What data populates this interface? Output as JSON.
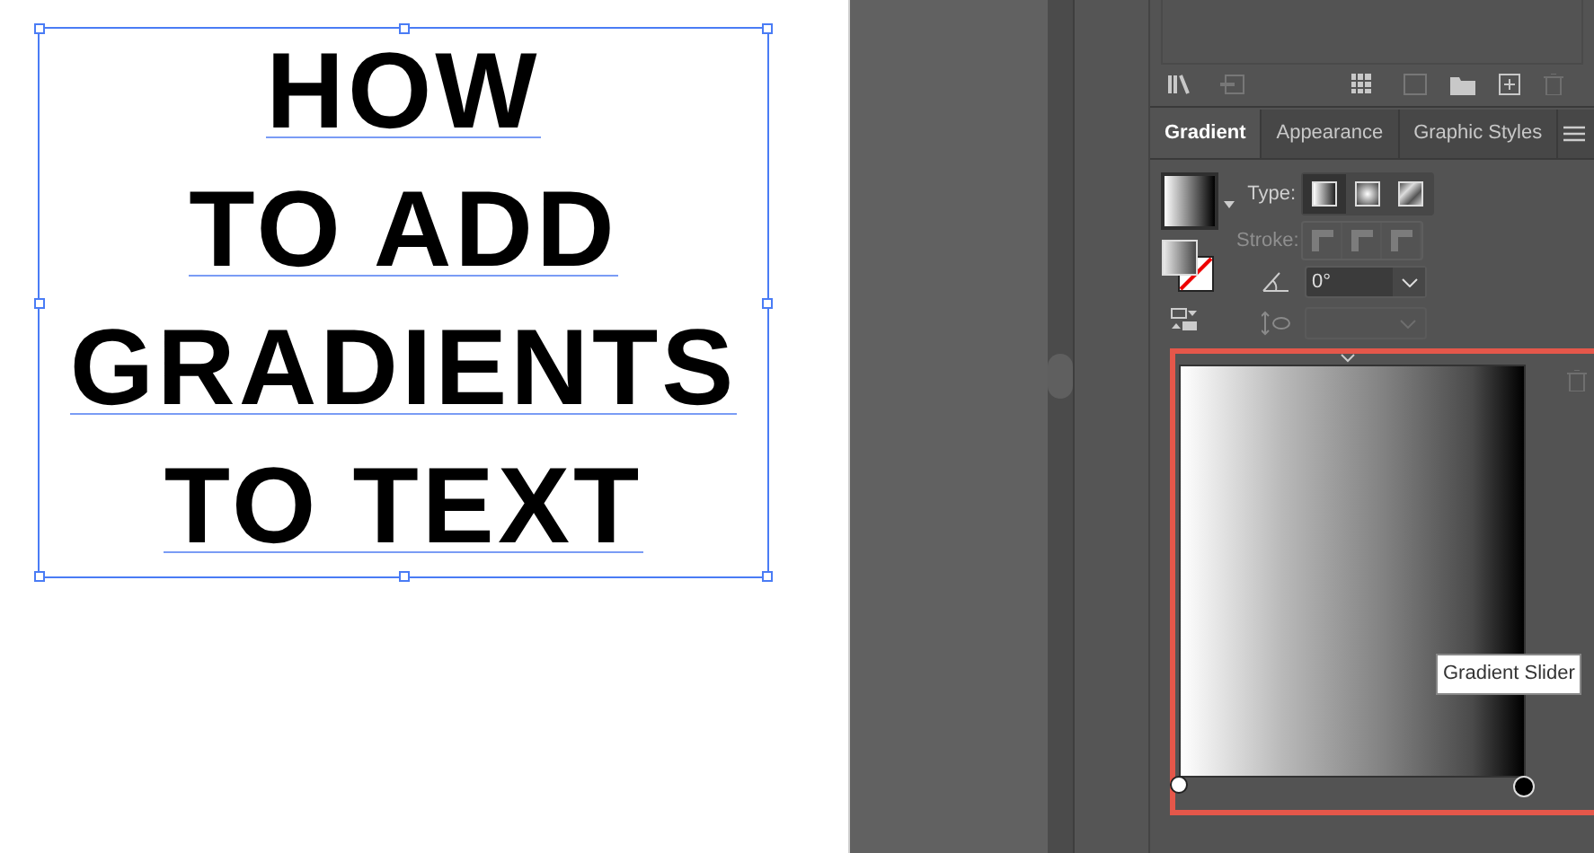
{
  "artboard": {
    "lines": [
      "HOW",
      "TO ADD",
      "GRADIENTS",
      "TO TEXT"
    ],
    "selected": true
  },
  "panel": {
    "tabs": [
      {
        "label": "Gradient",
        "selected": true
      },
      {
        "label": "Appearance",
        "selected": false
      },
      {
        "label": "Graphic Styles",
        "selected": false
      }
    ],
    "type_label": "Type:",
    "gradient_types": [
      {
        "kind": "linear",
        "selected": true
      },
      {
        "kind": "radial",
        "selected": false
      },
      {
        "kind": "freeform",
        "selected": false
      }
    ],
    "stroke_label": "Stroke:",
    "stroke_disabled": true,
    "angle": "0°",
    "gradient_slider": {
      "highlighted": true
    },
    "tooltip": "Gradient Slider"
  }
}
